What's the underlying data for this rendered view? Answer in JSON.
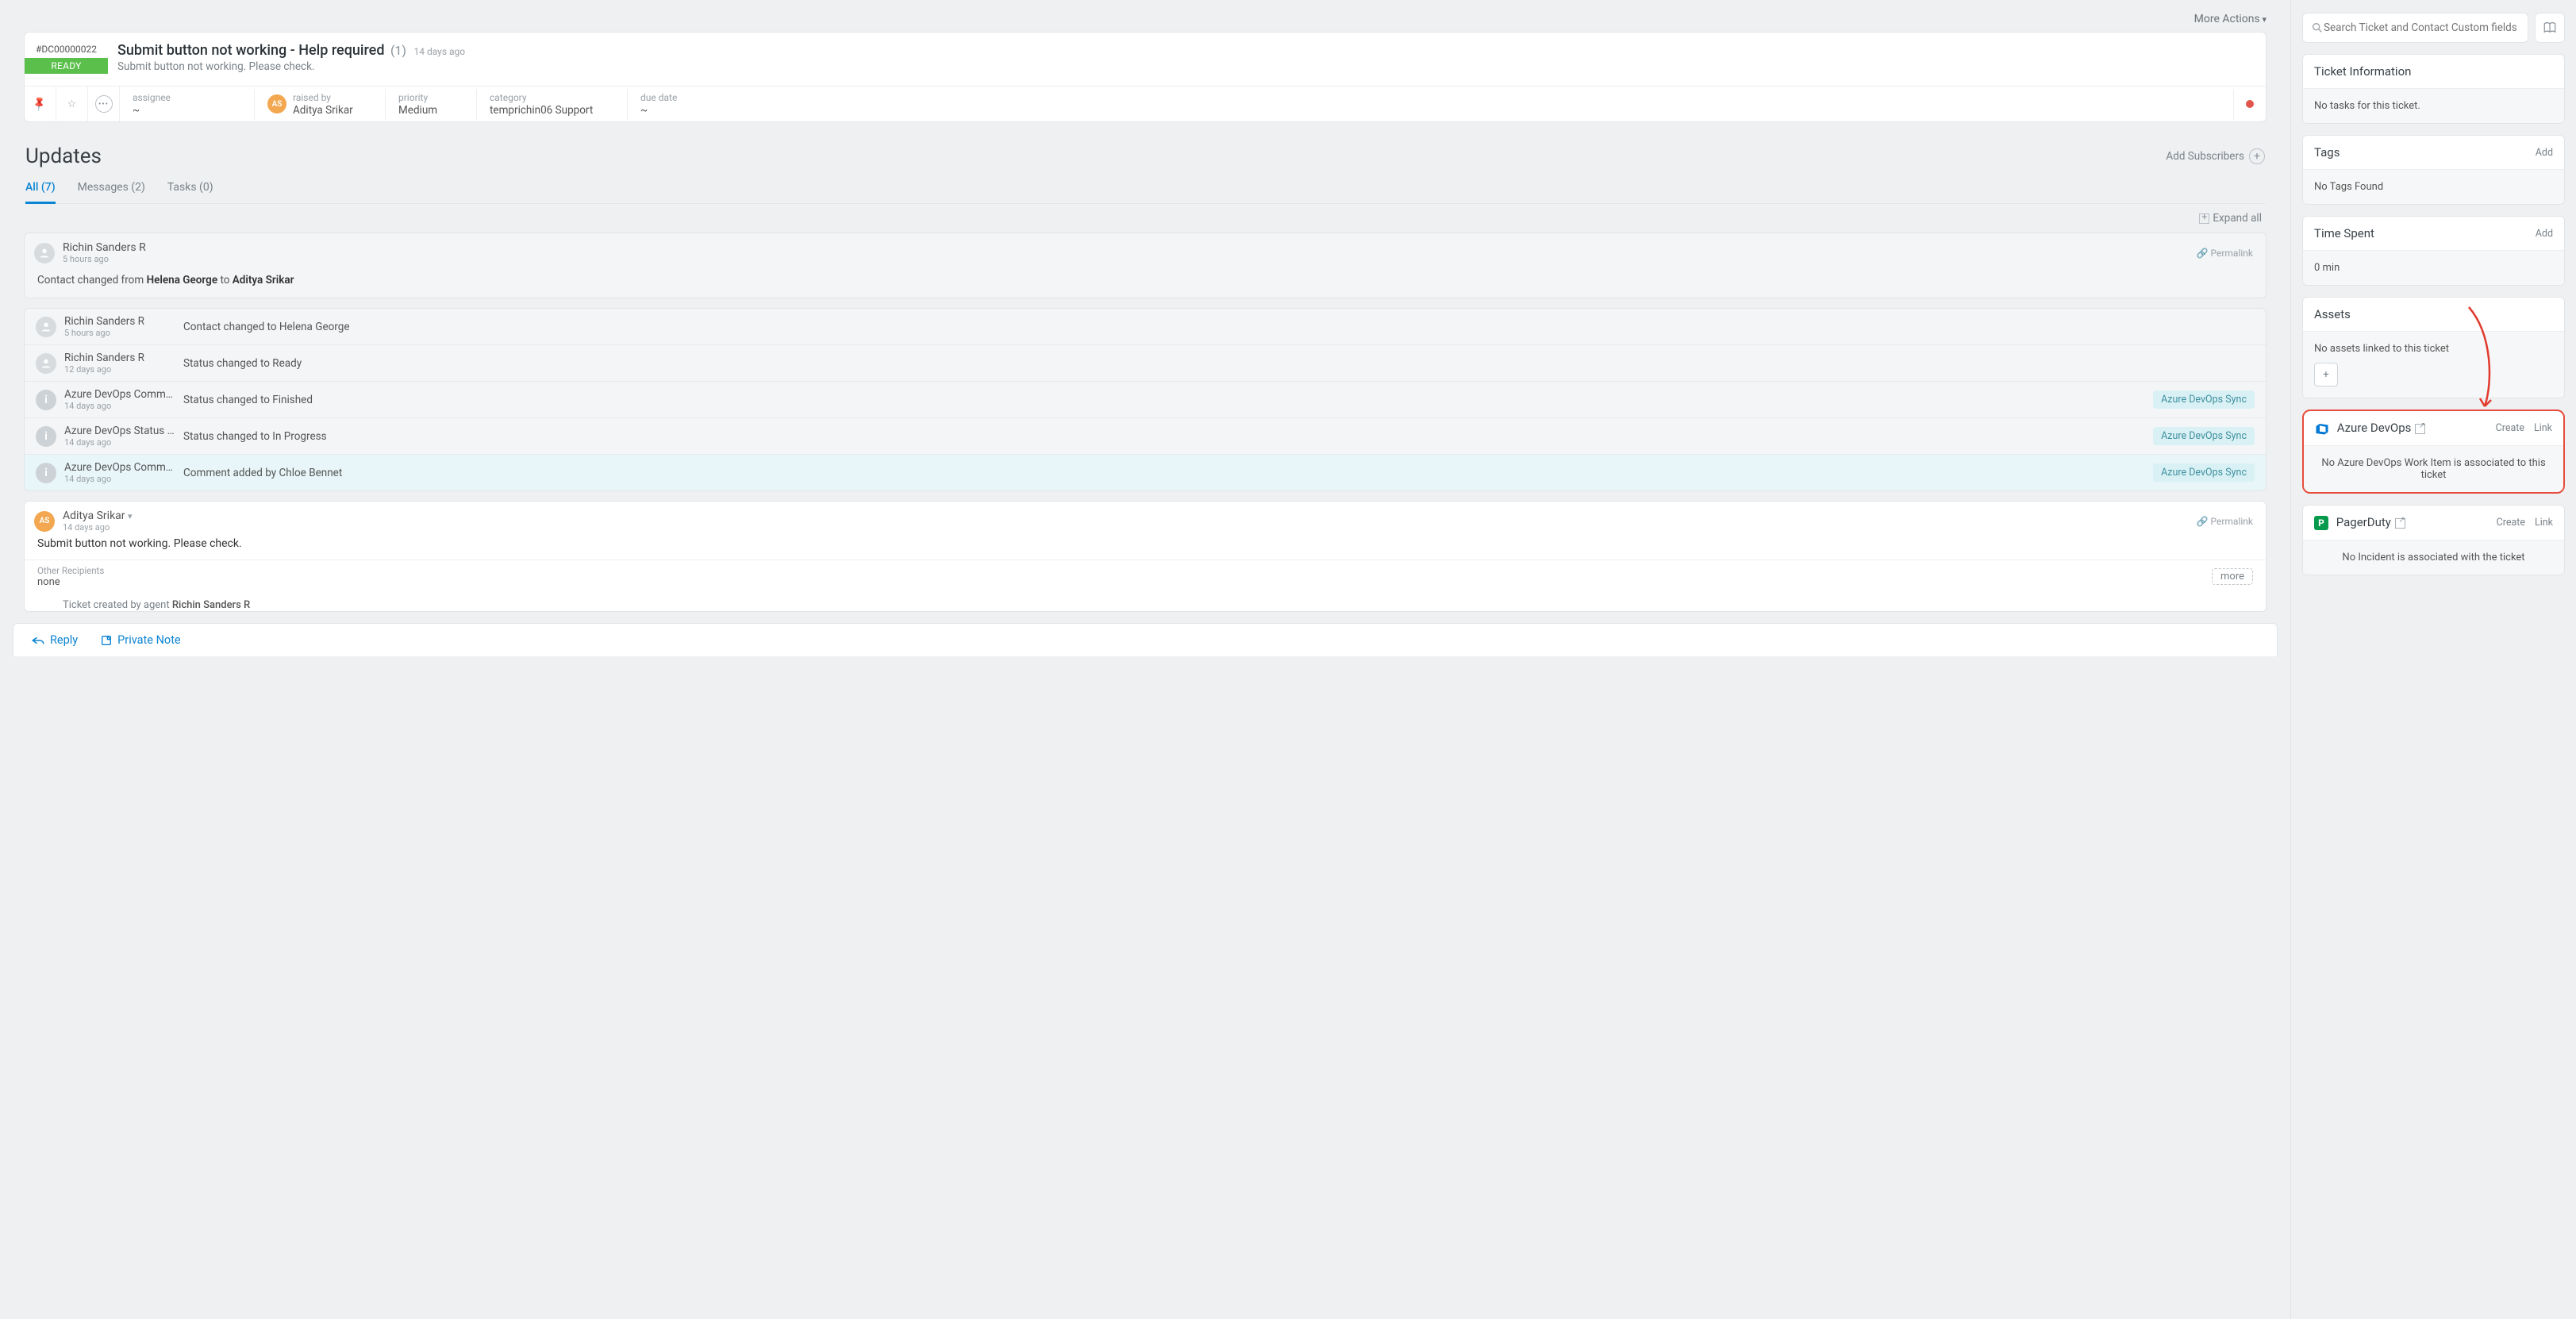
{
  "header": {
    "more_actions": "More Actions"
  },
  "ticket": {
    "id": "#DC00000022",
    "status": "READY",
    "title": "Submit button not working - Help required",
    "count": "(1)",
    "age": "14 days ago",
    "desc": "Submit button not working. Please check.",
    "fields": {
      "assignee_label": "assignee",
      "assignee": "~",
      "raised_label": "raised by",
      "raised_initials": "AS",
      "raised_by": "Aditya Srikar",
      "priority_label": "priority",
      "priority": "Medium",
      "category_label": "category",
      "category": "temprichin06 Support",
      "due_label": "due date",
      "due": "~"
    }
  },
  "updates": {
    "heading": "Updates",
    "add_subscribers": "Add Subscribers",
    "tabs": {
      "all": "All (7)",
      "messages": "Messages (2)",
      "tasks": "Tasks (0)"
    },
    "expand_all": "Expand all",
    "permalink": "Permalink",
    "first": {
      "name": "Richin Sanders R",
      "time": "5 hours ago",
      "pre": "Contact changed from ",
      "mid1": "Helena George",
      "mid2": " to ",
      "mid3": "Aditya Srikar"
    },
    "rows": [
      {
        "name": "Richin Sanders R",
        "time": "5 hours ago",
        "msg": "Contact changed to Helena George",
        "badge": "",
        "avatar": "user"
      },
      {
        "name": "Richin Sanders R",
        "time": "12 days ago",
        "msg": "Status changed to Ready",
        "badge": "",
        "avatar": "user"
      },
      {
        "name": "Azure DevOps Comm…",
        "time": "14 days ago",
        "msg": "Status changed to Finished",
        "badge": "Azure DevOps Sync",
        "avatar": "info"
      },
      {
        "name": "Azure DevOps Status …",
        "time": "14 days ago",
        "msg": "Status changed to In Progress",
        "badge": "Azure DevOps Sync",
        "avatar": "info"
      },
      {
        "name": "Azure DevOps Comm…",
        "time": "14 days ago",
        "msg": "Comment added by Chloe Bennet",
        "badge": "Azure DevOps Sync",
        "avatar": "info",
        "cyan": true
      }
    ],
    "msg": {
      "name": "Aditya Srikar",
      "initials": "AS",
      "time": "14 days ago",
      "body": "Submit button not working. Please check.",
      "other_label": "Other Recipients",
      "other_val": "none",
      "more": "more",
      "created_pre": "Ticket created by agent ",
      "created_by": "Richin Sanders R"
    }
  },
  "footer": {
    "reply": "Reply",
    "note": "Private Note"
  },
  "side": {
    "search_placeholder": "Search Ticket and Contact Custom fields",
    "ticket_info": {
      "title": "Ticket Information",
      "body": "No tasks for this ticket."
    },
    "tags": {
      "title": "Tags",
      "add": "Add",
      "body": "No Tags Found"
    },
    "time": {
      "title": "Time Spent",
      "add": "Add",
      "body": "0 min"
    },
    "assets": {
      "title": "Assets",
      "body": "No assets linked to this ticket"
    },
    "azure": {
      "title": "Azure DevOps",
      "create": "Create",
      "link": "Link",
      "body": "No Azure DevOps Work Item is associated to this ticket"
    },
    "pd": {
      "title": "PagerDuty",
      "create": "Create",
      "link": "Link",
      "body": "No Incident is associated with the ticket"
    }
  }
}
